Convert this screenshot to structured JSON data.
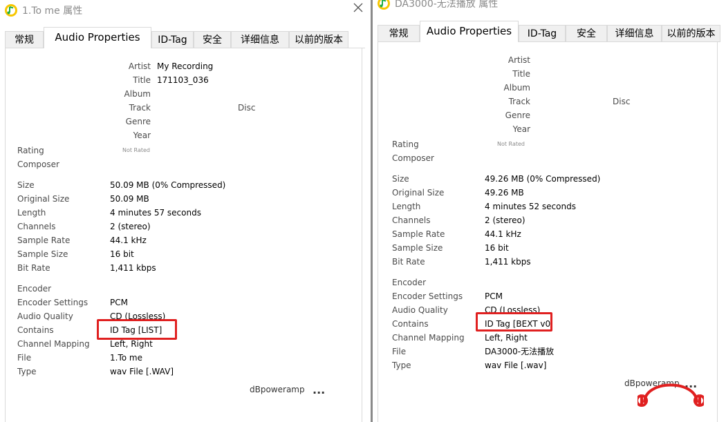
{
  "left": {
    "title": "1.To me 属性",
    "tabs": [
      "常规",
      "Audio Properties",
      "ID-Tag",
      "安全",
      "详细信息",
      "以前的版本"
    ],
    "tag_labels": {
      "artist": "Artist",
      "title": "Title",
      "album": "Album",
      "track": "Track",
      "disc": "Disc",
      "genre": "Genre",
      "year": "Year"
    },
    "tag_values": {
      "artist": "My Recording",
      "title": "171103_036"
    },
    "rating_label": "Rating",
    "rating_value": "Not Rated",
    "composer_label": "Composer",
    "props": {
      "size": {
        "label": "Size",
        "value": "50.09 MB  (0% Compressed)"
      },
      "original_size": {
        "label": "Original Size",
        "value": "50.09 MB"
      },
      "length": {
        "label": "Length",
        "value": "4 minutes 57 seconds"
      },
      "channels": {
        "label": "Channels",
        "value": "2  (stereo)"
      },
      "sample_rate": {
        "label": "Sample Rate",
        "value": "44.1 kHz"
      },
      "sample_size": {
        "label": "Sample Size",
        "value": "16 bit"
      },
      "bit_rate": {
        "label": "Bit Rate",
        "value": "1,411 kbps"
      },
      "encoder": {
        "label": "Encoder",
        "value": ""
      },
      "encoder_settings": {
        "label": "Encoder Settings",
        "value": "PCM"
      },
      "audio_quality": {
        "label": "Audio Quality",
        "value": "CD  (Lossless)"
      },
      "contains": {
        "label": "Contains",
        "value": "ID Tag [LIST]"
      },
      "channel_mapping": {
        "label": "Channel Mapping",
        "value": "Left, Right"
      },
      "file": {
        "label": "File",
        "value": "1.To me"
      },
      "type": {
        "label": "Type",
        "value": "wav File    [.WAV]"
      }
    },
    "brand": "dBpoweramp",
    "more": "..."
  },
  "right": {
    "title": "DA3000-无法播放 属性",
    "tabs": [
      "常规",
      "Audio Properties",
      "ID-Tag",
      "安全",
      "详细信息",
      "以前的版本"
    ],
    "tag_labels": {
      "artist": "Artist",
      "title": "Title",
      "album": "Album",
      "track": "Track",
      "disc": "Disc",
      "genre": "Genre",
      "year": "Year"
    },
    "rating_label": "Rating",
    "rating_value": "Not Rated",
    "composer_label": "Composer",
    "props": {
      "size": {
        "label": "Size",
        "value": "49.26 MB  (0% Compressed)"
      },
      "original_size": {
        "label": "Original Size",
        "value": "49.26 MB"
      },
      "length": {
        "label": "Length",
        "value": "4 minutes 52 seconds"
      },
      "channels": {
        "label": "Channels",
        "value": "2  (stereo)"
      },
      "sample_rate": {
        "label": "Sample Rate",
        "value": "44.1 kHz"
      },
      "sample_size": {
        "label": "Sample Size",
        "value": "16 bit"
      },
      "bit_rate": {
        "label": "Bit Rate",
        "value": "1,411 kbps"
      },
      "encoder": {
        "label": "Encoder",
        "value": ""
      },
      "encoder_settings": {
        "label": "Encoder Settings",
        "value": "PCM"
      },
      "audio_quality": {
        "label": "Audio Quality",
        "value": "CD  (Lossless)"
      },
      "contains": {
        "label": "Contains",
        "value": "ID Tag [BEXT v0"
      },
      "channel_mapping": {
        "label": "Channel Mapping",
        "value": "Left, Right"
      },
      "file": {
        "label": "File",
        "value": "DA3000-无法播放"
      },
      "type": {
        "label": "Type",
        "value": "wav File    [.wav]"
      }
    },
    "brand": "dBpoweramp",
    "more": "..."
  },
  "colors": {
    "highlight": "#e02020",
    "label_text": "#4a4a4a",
    "tab_bg": "#f0f0f0",
    "border": "#d9d9d9",
    "title_text": "#8a8a8a"
  },
  "icons": {
    "app": "music-note-app-icon",
    "close": "close-icon",
    "logo": "headphones-logo-icon"
  }
}
